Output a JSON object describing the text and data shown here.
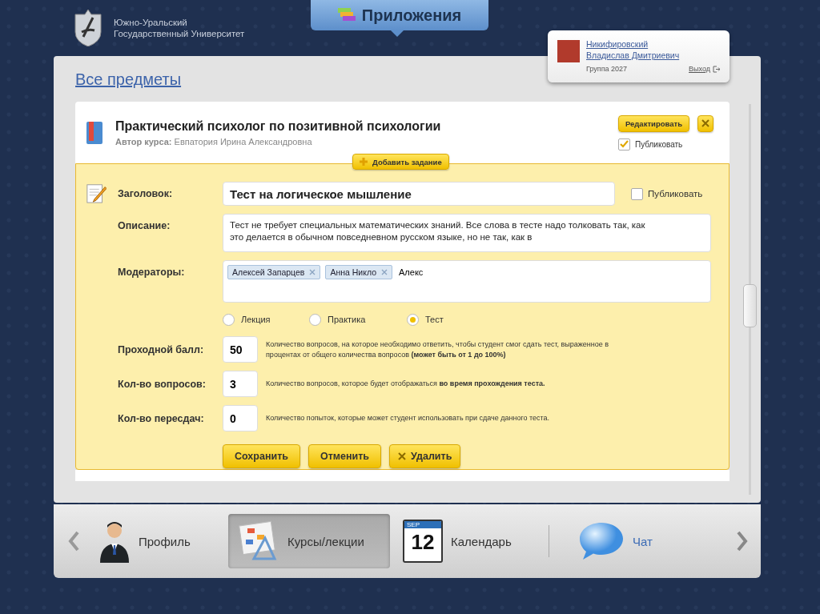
{
  "header": {
    "university": [
      "Южно-Уральский",
      "Государственный Университет"
    ],
    "apps_tab": "Приложения"
  },
  "user": {
    "surname": "Никифировский",
    "name": "Владислав Дмитриевич",
    "group": "Группа 2027",
    "logout": "Выход"
  },
  "breadcrumb": "Все предметы",
  "course": {
    "title": "Практический психолог по позитивной психологии",
    "author_label": "Автор курса:",
    "author": "Евпатория Ирина Александровна",
    "edit": "Редактировать",
    "publish": {
      "label": "Публиковать",
      "checked": true
    }
  },
  "add_task": "Добавить задание",
  "form": {
    "title_label": "Заголовок:",
    "title_value": "Тест на логическое мышление",
    "publish": {
      "label": "Публиковать",
      "checked": false
    },
    "description_label": "Описание:",
    "description_value": "Тест не требует специальных математических знаний. Все слова в тесте надо толковать так, как это делается в обычном повседневном русском языке, но не так, как в",
    "moderators_label": "Модераторы:",
    "moderators": [
      "Алексей Запарцев",
      "Анна Никло"
    ],
    "moderator_input": "Алекс",
    "types": [
      {
        "label": "Лекция",
        "selected": false
      },
      {
        "label": "Практика",
        "selected": false
      },
      {
        "label": "Тест",
        "selected": true
      }
    ],
    "settings": [
      {
        "label": "Проходной балл:",
        "value": "50",
        "hint": "Количество вопросов, на которое необходимо ответить, чтобы студент смог сдать тест, выраженное в процентах от общего количества вопросов **(может быть от 1 до 100%)**"
      },
      {
        "label": "Кол-во вопросов:",
        "value": "3",
        "hint": "Количество вопросов, которое будет отображаться **во время прохождения теста.**"
      },
      {
        "label": "Кол-во пересдач:",
        "value": "0",
        "hint": "Количество попыток, которые может студент использовать при сдаче данного теста."
      }
    ],
    "buttons": [
      {
        "label": "Сохранить",
        "kind": "plain"
      },
      {
        "label": "Отменить",
        "kind": "plain"
      },
      {
        "label": "Удалить",
        "kind": "delete"
      }
    ]
  },
  "dock": [
    {
      "label": "Профиль",
      "kind": "profile",
      "selected": false
    },
    {
      "label": "Курсы/лекции",
      "kind": "courses",
      "selected": true
    },
    {
      "label": "Календарь",
      "kind": "calendar",
      "selected": false,
      "month": "SEP",
      "day": "12"
    },
    {
      "label": "Чат",
      "kind": "chat",
      "selected": false
    }
  ]
}
